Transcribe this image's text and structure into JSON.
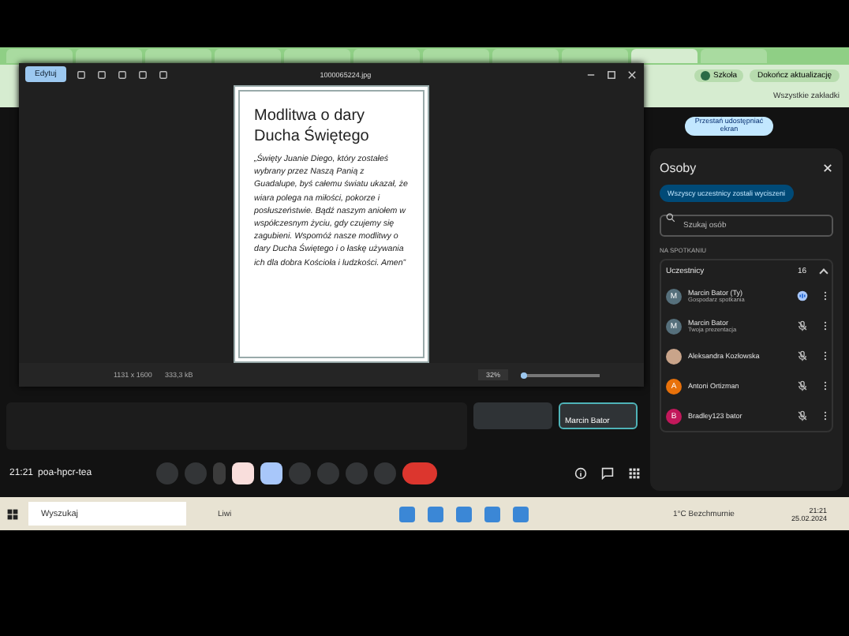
{
  "browser": {
    "profile": "Szkoła",
    "update_button": "Dokończ aktualizację",
    "bookmarks": "Wszystkie zakładki"
  },
  "viewer": {
    "edit_button": "Edytuj",
    "filename": "1000065224.jpg",
    "dimensions": "1131 x 1600",
    "filesize": "333,3 kB",
    "zoom": "32%",
    "zoom_slider": {
      "level": 0.05
    },
    "poster": {
      "title": "Modlitwa o dary Ducha Świętego",
      "text": "„Święty Juanie Diego, który zostałeś wybrany przez Naszą Panią z Guadalupe, byś całemu światu ukazał, że wiara polega na miłości, pokorze i posłuszeństwie. Bądź naszym aniołem w współczesnym życiu, gdy czujemy się zagubieni. Wspomóż nasze modlitwy o dary Ducha Świętego i o łaskę używania ich dla dobra Kościoła i ludzkości. Amen”"
    }
  },
  "stage": {
    "stop_sharing": "Przestań udostępniać ekran",
    "tile_name": "Marcin Bator"
  },
  "people": {
    "title": "Osoby",
    "mute_all": "Wszyscy uczestnicy zostali wyciszeni",
    "search": {
      "placeholder": "Szukaj osób"
    },
    "section": "NA SPOTKANIU",
    "group": "Uczestnicy",
    "count": "16",
    "expanded": true,
    "participants": [
      {
        "initial": "M",
        "name": "Marcin Bator (Ty)",
        "role": "Gospodarz spotkania",
        "color": "#56707c",
        "muted": false
      },
      {
        "initial": "M",
        "name": "Marcin Bator",
        "role": "Twoja prezentacja",
        "color": "#56707c",
        "muted": true
      },
      {
        "name": "Aleksandra Kozłowska",
        "color": "#c9a48a",
        "muted": true
      },
      {
        "initial": "A",
        "name": "Antoni Ortizman",
        "color": "#e8710a",
        "muted": true
      },
      {
        "initial": "B",
        "name": "Bradley123 bator",
        "color": "#c2185b",
        "muted": true
      }
    ]
  },
  "meeting": {
    "time": "21:21",
    "code": "poa-hpcr-tea",
    "controls": [
      {
        "kind": "effects",
        "active": false
      },
      {
        "kind": "mic",
        "active": false
      },
      {
        "kind": "more-mic"
      },
      {
        "kind": "camera-off",
        "active": true
      },
      {
        "kind": "present",
        "active": true
      },
      {
        "kind": "emoji",
        "active": false
      },
      {
        "kind": "captions",
        "active": false
      },
      {
        "kind": "hand",
        "active": false
      },
      {
        "kind": "more",
        "active": false
      },
      {
        "kind": "hangup"
      }
    ]
  },
  "taskbar": {
    "search": {
      "placeholder": "Wyszukaj"
    },
    "widget": "Liwi",
    "weather": "1°C  Bezchmurnie",
    "time": "21:21",
    "date": "25.02.2024"
  }
}
